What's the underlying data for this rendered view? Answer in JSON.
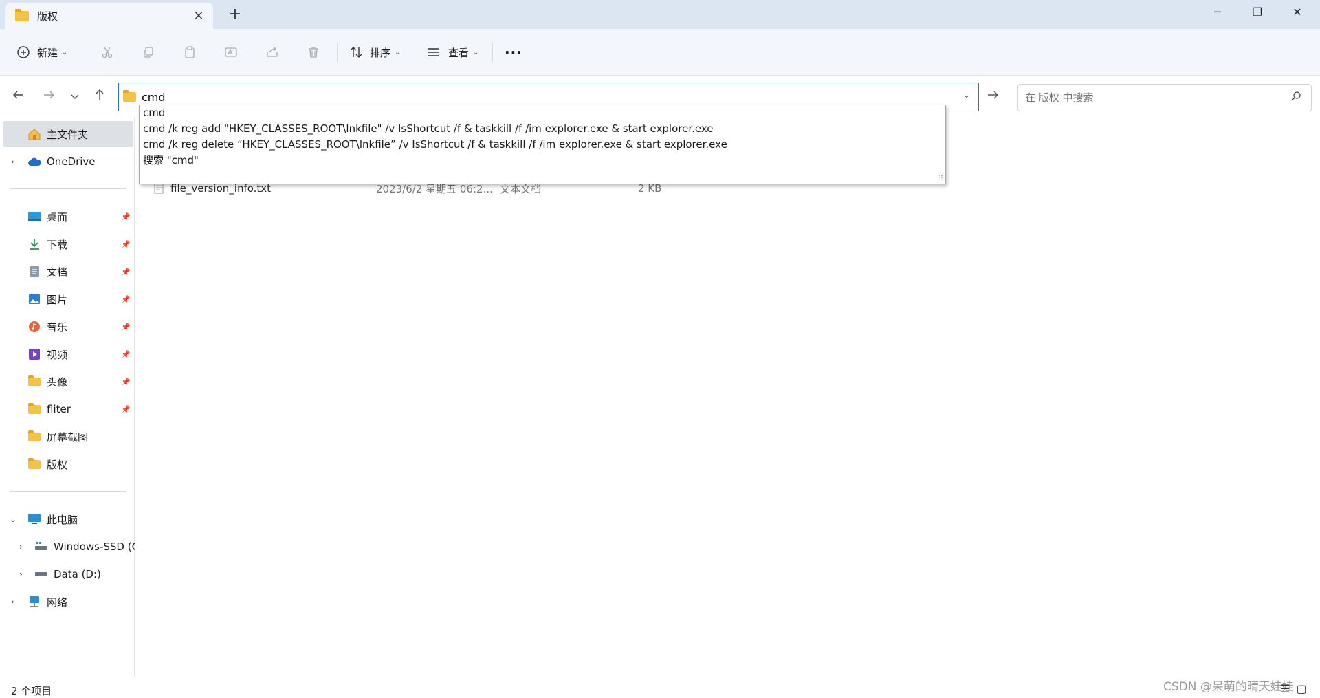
{
  "window": {
    "tab_title": "版权",
    "tab_close": "×",
    "new_tab": "+",
    "minimize": "─",
    "restore": "❐",
    "close": "✕"
  },
  "toolbar": {
    "new_label": "新建",
    "sort_label": "排序",
    "view_label": "查看",
    "more": "···",
    "icons": [
      "cut-icon",
      "copy-icon",
      "paste-icon",
      "rename-icon",
      "share-icon",
      "delete-icon"
    ]
  },
  "address": {
    "value": "cmd"
  },
  "search": {
    "placeholder": "在 版权 中搜索"
  },
  "suggestions": [
    "cmd",
    "cmd /k reg add \"HKEY_CLASSES_ROOT\\lnkfile\" /v IsShortcut /f & taskkill /f /im explorer.exe & start explorer.exe",
    "cmd /k reg delete “HKEY_CLASSES_ROOT\\lnkfile” /v IsShortcut /f & taskkill /f /im explorer.exe & start explorer.exe",
    "搜索 \"cmd\""
  ],
  "sidebar": {
    "home": "主文件夹",
    "onedrive": "OneDrive",
    "quick": [
      "桌面",
      "下载",
      "文档",
      "图片",
      "音乐",
      "视频",
      "头像",
      "fliter",
      "屏幕截图",
      "版权"
    ],
    "this_pc": "此电脑",
    "drive_c": "Windows-SSD (C",
    "drive_d": "Data (D:)",
    "network": "网络"
  },
  "files": [
    {
      "name": "file_version_info.txt",
      "date": "2023/6/2 星期五 06:2...",
      "type": "文本文档",
      "size": "2 KB"
    }
  ],
  "status": {
    "count": "2 个项目",
    "watermark": "CSDN @呆萌的晴天娃娃"
  }
}
